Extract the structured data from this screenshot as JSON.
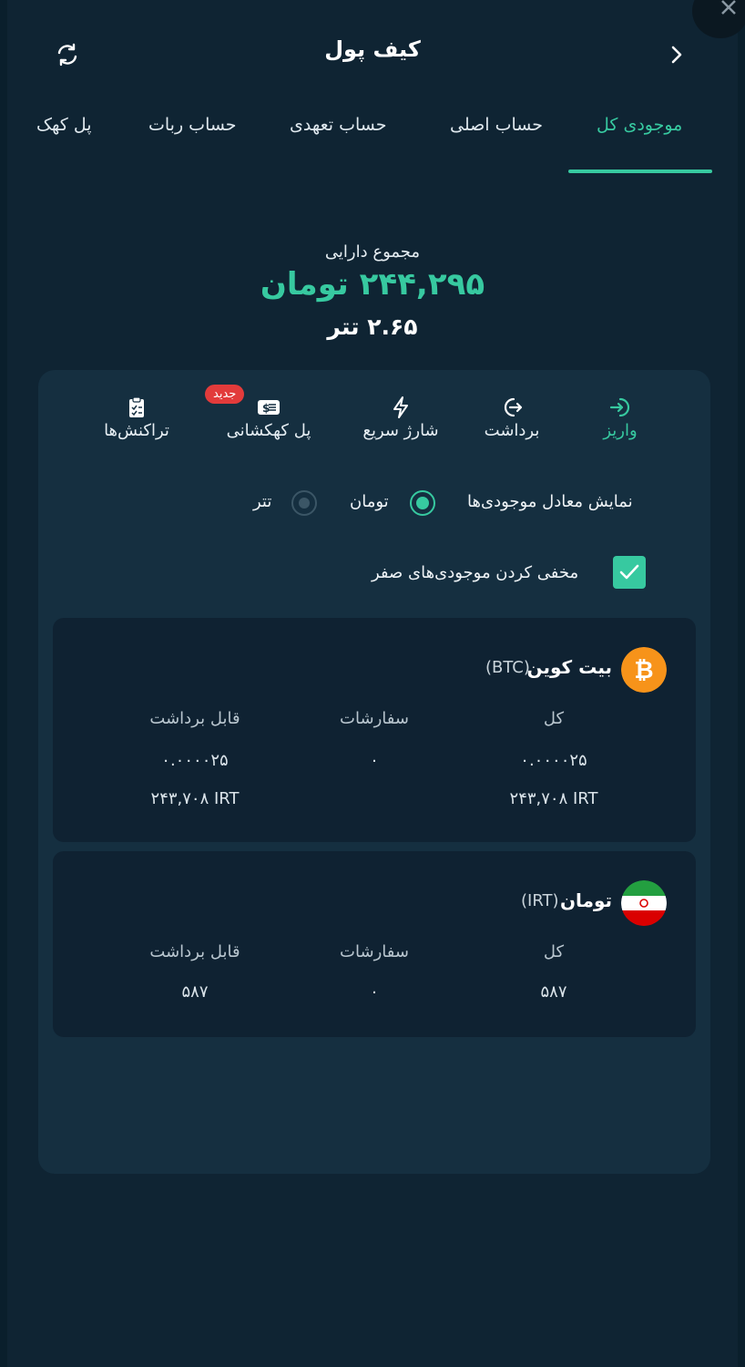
{
  "header": {
    "title": "کیف پول",
    "refresh_icon": "refresh-icon",
    "back_icon": "chevron-right-icon"
  },
  "tabs": [
    {
      "label": "موجودی کل",
      "active": true
    },
    {
      "label": "حساب اصلی",
      "active": false
    },
    {
      "label": "حساب تعهدی",
      "active": false
    },
    {
      "label": "حساب ربات",
      "active": false
    },
    {
      "label": "پل کهک",
      "active": false
    }
  ],
  "summary": {
    "label": "مجموع دارایی",
    "toman": "۲۴۴,۲۹۵ تومان",
    "usdt": "۲.۶۵ تتر"
  },
  "actions": [
    {
      "label": "واریز",
      "icon": "deposit-icon",
      "active": true
    },
    {
      "label": "برداشت",
      "icon": "withdraw-icon",
      "active": false
    },
    {
      "label": "شارژ سریع",
      "icon": "lightning-icon",
      "active": false
    },
    {
      "label": "پل کهکشانی",
      "icon": "bridge-icon",
      "active": false,
      "badge": "جدید"
    },
    {
      "label": "تراکنش‌ها",
      "icon": "clipboard-icon",
      "active": false
    }
  ],
  "display_options": {
    "label": "نمایش معادل موجودی‌ها",
    "options": [
      {
        "label": "تومان",
        "selected": true
      },
      {
        "label": "تتر",
        "selected": false
      }
    ]
  },
  "hide_zero": {
    "label": "مخفی کردن موجودی‌های صفر",
    "checked": true
  },
  "balances": [
    {
      "name": "بیت کوین",
      "code": "(BTC)",
      "icon": "bitcoin-icon",
      "columns": [
        "کل",
        "سفارشات",
        "قابل برداشت"
      ],
      "total": "۰.۰۰۰۰۲۵",
      "total_irt": "۲۴۳,۷۰۸ IRT",
      "orders": "۰",
      "withdrawable": "۰.۰۰۰۰۲۵",
      "withdrawable_irt": "۲۴۳,۷۰۸ IRT"
    },
    {
      "name": "تومان",
      "code": "(IRT)",
      "icon": "iran-flag-icon",
      "columns": [
        "کل",
        "سفارشات",
        "قابل برداشت"
      ],
      "total": "۵۸۷",
      "orders": "۰",
      "withdrawable": "۵۸۷"
    }
  ],
  "colors": {
    "accent": "#37c9a0",
    "background": "#0f2433",
    "panel": "#152f40",
    "card": "#0f2232",
    "badge": "#e23b3b"
  }
}
